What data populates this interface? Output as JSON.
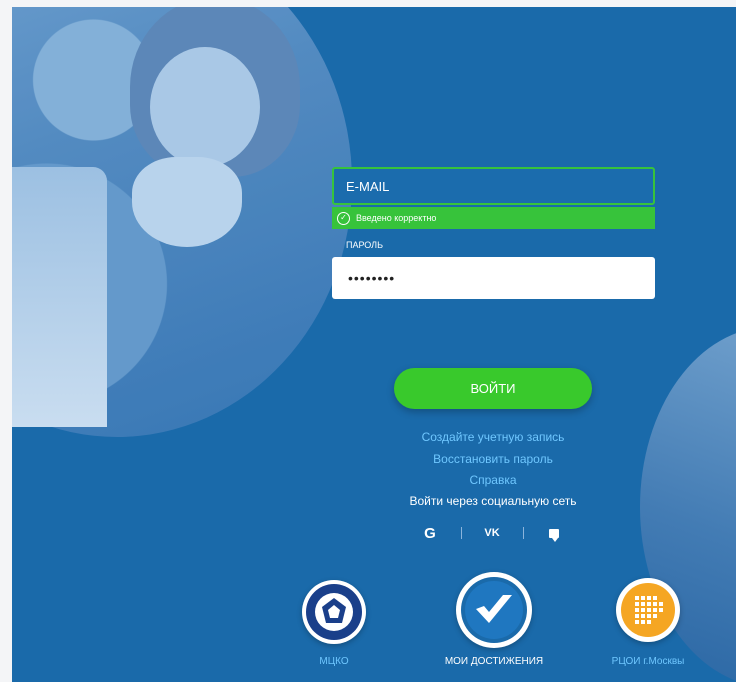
{
  "form": {
    "email_label": "E-MAIL",
    "validation_text": "Введено корректно",
    "password_label": "ПАРОЛЬ",
    "password_value": "••••••••",
    "login_button": "ВОЙТИ"
  },
  "links": {
    "create_account": "Создайте учетную запись",
    "restore_password": "Восстановить пароль",
    "help": "Справка",
    "social_login": "Войти через социальную сеть"
  },
  "social": {
    "google": "G",
    "vk": "VK"
  },
  "logos": {
    "mcko": "МЦКО",
    "achievements": "МОИ ДОСТИЖЕНИЯ",
    "rcoi": "РЦОИ г.Москвы"
  },
  "colors": {
    "background": "#1a6aaa",
    "accent_green": "#37c33b",
    "link_blue": "#6fc7ff",
    "rcoi_orange": "#f5a623"
  }
}
